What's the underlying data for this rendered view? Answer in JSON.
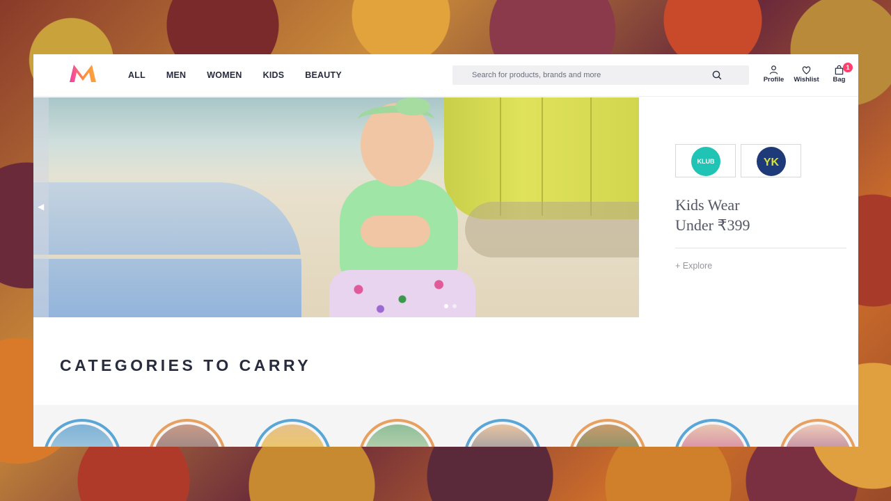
{
  "header": {
    "nav": [
      "ALL",
      "MEN",
      "WOMEN",
      "KIDS",
      "BEAUTY"
    ],
    "search_placeholder": "Search for products, brands and more",
    "actions": [
      {
        "label": "Profile",
        "icon": "profile-icon"
      },
      {
        "label": "Wishlist",
        "icon": "heart-icon"
      },
      {
        "label": "Bag",
        "icon": "bag-icon"
      }
    ],
    "bag_count": "1"
  },
  "promo": {
    "brands": [
      "KLUB",
      "YK"
    ],
    "title_line1": "Kids Wear",
    "title_line2": "Under ₹399",
    "explore": "+ Explore"
  },
  "categories": {
    "title": "CATEGORIES TO CARRY"
  },
  "colors": {
    "brand_pink": "#ff3f6c",
    "text_dark": "#282c3f",
    "text_muted": "#94969f"
  }
}
